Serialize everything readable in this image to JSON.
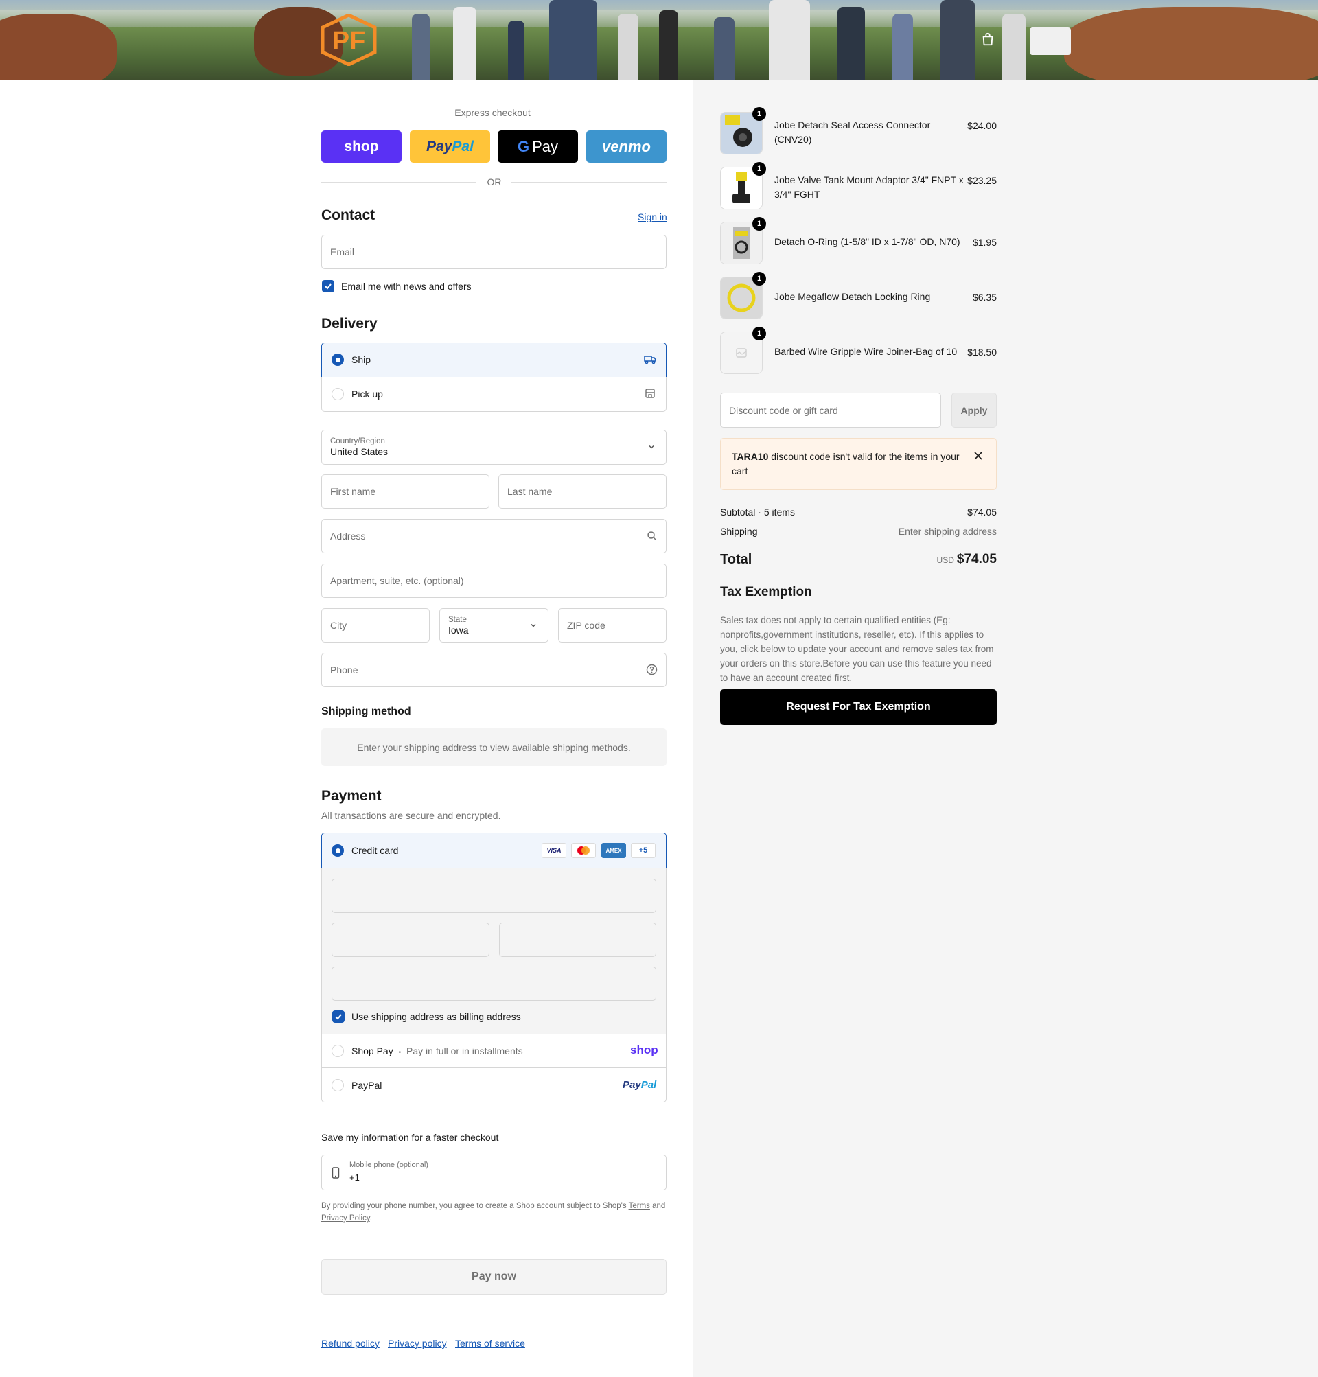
{
  "header": {
    "logo_text": "PF",
    "cart_icon": "shopping-bag-icon"
  },
  "express": {
    "label": "Express checkout",
    "buttons": {
      "shop": "shop",
      "paypal_a": "Pay",
      "paypal_b": "Pal",
      "gpay_g": "G",
      "gpay_pay": "Pay",
      "venmo": "venmo"
    },
    "or": "OR"
  },
  "contact": {
    "title": "Contact",
    "sign_in": "Sign in",
    "email_placeholder": "Email",
    "newsletter_label": "Email me with news and offers"
  },
  "delivery": {
    "title": "Delivery",
    "options": [
      {
        "label": "Ship",
        "selected": true,
        "icon": "truck-icon"
      },
      {
        "label": "Pick up",
        "selected": false,
        "icon": "store-icon"
      }
    ],
    "country_label": "Country/Region",
    "country_value": "United States",
    "first_name": "First name",
    "last_name": "Last name",
    "address": "Address",
    "apartment": "Apartment, suite, etc. (optional)",
    "city": "City",
    "state_label": "State",
    "state_value": "Iowa",
    "zip": "ZIP code",
    "phone": "Phone"
  },
  "shipping_method": {
    "title": "Shipping method",
    "notice": "Enter your shipping address to view available shipping methods."
  },
  "payment": {
    "title": "Payment",
    "subtitle": "All transactions are secure and encrypted.",
    "credit_card": "Credit card",
    "card_logos": {
      "visa": "VISA",
      "amex": "AMEX",
      "more": "+5"
    },
    "billing_same": "Use shipping address as billing address",
    "shop_pay": "Shop Pay",
    "shop_pay_sep": "•",
    "shop_pay_note": "Pay in full or in installments",
    "shop_pay_logo": "shop",
    "paypal": "PayPal",
    "paypal_logo_a": "Pay",
    "paypal_logo_b": "Pal"
  },
  "save_info": {
    "title": "Save my information for a faster checkout",
    "mobile_label": "Mobile phone (optional)",
    "mobile_value": "+1",
    "legal_1": "By providing your phone number, you agree to create a Shop account subject to Shop's",
    "terms": "Terms",
    "legal_and": "and",
    "privacy": "Privacy Policy",
    "legal_end": "."
  },
  "pay_now": "Pay now",
  "footer": {
    "links": [
      "Refund policy",
      "Privacy policy",
      "Terms of service"
    ]
  },
  "cart": {
    "items": [
      {
        "name": "Jobe Detach Seal Access Connector (CNV20)",
        "price": "$24.00",
        "qty": "1"
      },
      {
        "name": "Jobe Valve Tank Mount Adaptor 3/4\" FNPT x 3/4\" FGHT",
        "price": "$23.25",
        "qty": "1"
      },
      {
        "name": "Detach O-Ring (1-5/8\" ID x 1-7/8\" OD, N70)",
        "price": "$1.95",
        "qty": "1"
      },
      {
        "name": "Jobe Megaflow Detach Locking Ring",
        "price": "$6.35",
        "qty": "1"
      },
      {
        "name": "Barbed Wire Gripple Wire Joiner-Bag of 10",
        "price": "$18.50",
        "qty": "1"
      }
    ],
    "discount_placeholder": "Discount code or gift card",
    "apply": "Apply",
    "error_code": "TARA10",
    "error_text": " discount code isn't valid for the items in your cart",
    "subtotal_label": "Subtotal · 5 items",
    "subtotal_value": "$74.05",
    "shipping_label": "Shipping",
    "shipping_value": "Enter shipping address",
    "total_label": "Total",
    "currency": "USD",
    "total_value": "$74.05"
  },
  "tax": {
    "title": "Tax Exemption",
    "text": "Sales tax does not apply to certain qualified entities (Eg: nonprofits,government institutions, reseller, etc). If this applies to you, click below to update your account and remove sales tax from your orders on this store.Before you can use this feature you need to have an account created first.",
    "button": "Request For Tax Exemption"
  },
  "colors": {
    "accent": "#1658b5",
    "shop_purple": "#5a31f4",
    "paypal_yellow": "#ffc439",
    "venmo_blue": "#3d95ce",
    "error_bg": "#fff4ea"
  }
}
